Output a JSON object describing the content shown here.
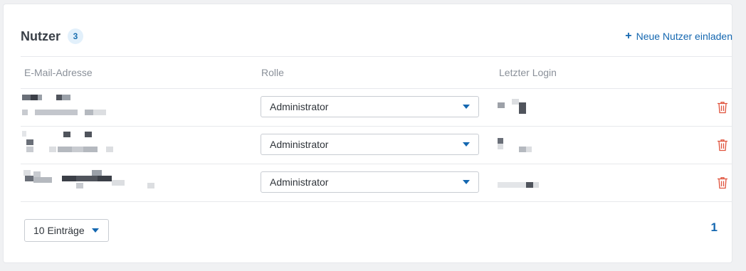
{
  "header": {
    "title": "Nutzer",
    "count": "3",
    "invite_label": "Neue Nutzer einladen",
    "invite_icon": "plus-icon"
  },
  "table": {
    "columns": [
      "E-Mail-Adresse",
      "Rolle",
      "Letzter Login"
    ],
    "rows": [
      {
        "role": "Administrator"
      },
      {
        "role": "Administrator"
      },
      {
        "role": "Administrator"
      }
    ],
    "delete_icon": "trash-icon"
  },
  "footer": {
    "page_size": "10 Einträge",
    "current_page": "1"
  },
  "colors": {
    "accent": "#1467b0",
    "delete": "#e0533d",
    "badge_bg": "#e2f0fb"
  }
}
